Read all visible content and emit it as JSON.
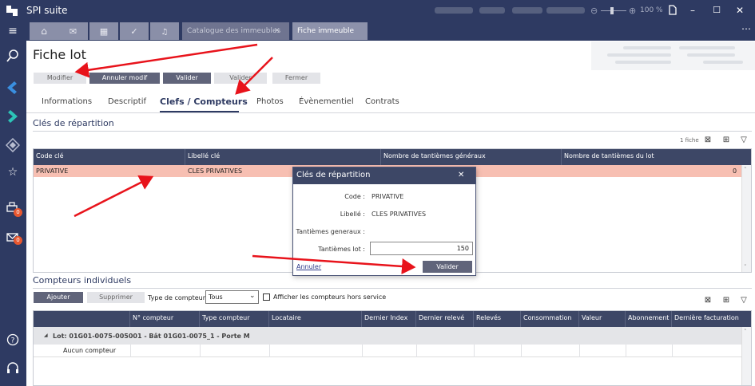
{
  "app": {
    "name": "SPI suite",
    "zoom": "100 %",
    "window_buttons": [
      "–",
      "☐",
      "✕"
    ]
  },
  "nav": {
    "print_badge": "0",
    "mail_badge": "0"
  },
  "tabs": {
    "doc_tabs": [
      {
        "label": "Catalogue des immeubles",
        "close": "✕"
      },
      {
        "label": "Fiche immeuble"
      }
    ],
    "more": "⋯"
  },
  "page": {
    "title": "Fiche lot",
    "actions": [
      "Modifier",
      "Annuler modif",
      "Valider",
      "Valider",
      "Fermer"
    ],
    "subtabs": [
      "Informations",
      "Descriptif",
      "Clefs / Compteurs",
      "Photos",
      "Évènementiel",
      "Contrats"
    ]
  },
  "cles": {
    "section_title": "Clés de répartition",
    "count": "1 fiche",
    "columns": [
      "Code clé",
      "Libellé clé",
      "Nombre de tantièmes généraux",
      "Nombre de tantièmes du lot"
    ],
    "rows": [
      {
        "code": "PRIVATIVE",
        "libelle": "CLES PRIVATIVES",
        "generaux": "",
        "lot": "0"
      }
    ]
  },
  "dialog": {
    "title": "Clés de répartition",
    "close": "✕",
    "code_label": "Code :",
    "code_value": "PRIVATIVE",
    "libelle_label": "Libellé :",
    "libelle_value": "CLES PRIVATIVES",
    "generaux_label": "Tantièmes generaux :",
    "lot_label": "Tantièmes lot :",
    "lot_value": "150",
    "cancel": "Annuler",
    "ok": "Valider"
  },
  "compteurs": {
    "section_title": "Compteurs individuels",
    "add": "Ajouter",
    "remove": "Supprimer",
    "type_label": "Type de compteur :",
    "type_value": "Tous",
    "hors_service": "Afficher les compteurs hors service",
    "columns": [
      "N° compteur",
      "Type compteur",
      "Locataire",
      "Dernier Index",
      "Dernier relevé",
      "Relevés",
      "Consommation",
      "Valeur",
      "Abonnement",
      "Dernière facturation"
    ],
    "group": "Lot: 01G01-0075-005001 - Bât 01G01-0075_1 - Porte M",
    "empty": "Aucun compteur"
  },
  "colors": {
    "navy": "#2e3a62",
    "header": "#3d4766",
    "selected_row": "#f5b9aa",
    "arrow": "#e8131b",
    "badge": "#e8572f"
  }
}
